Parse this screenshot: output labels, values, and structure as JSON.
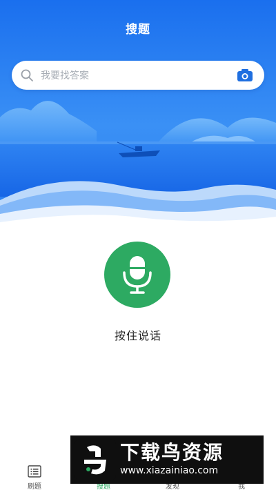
{
  "header": {
    "title": "搜题"
  },
  "search": {
    "placeholder": "我要找答案",
    "icon": "search-icon",
    "camera_icon": "camera-icon"
  },
  "voice": {
    "label": "按住说话",
    "icon": "microphone-icon"
  },
  "tabs": [
    {
      "label": "刷题",
      "icon": "list-icon"
    },
    {
      "label": "搜题",
      "icon": "search-icon",
      "active": true
    },
    {
      "label": "发现",
      "icon": "compass-icon"
    },
    {
      "label": "我",
      "icon": "user-icon"
    }
  ],
  "watermark": {
    "brand": "下载鸟资源",
    "url": "www.xiazainiao.com"
  },
  "colors": {
    "primary_blue": "#1f73f0",
    "accent_green": "#2daa62",
    "camera_blue": "#1f6fe0"
  }
}
